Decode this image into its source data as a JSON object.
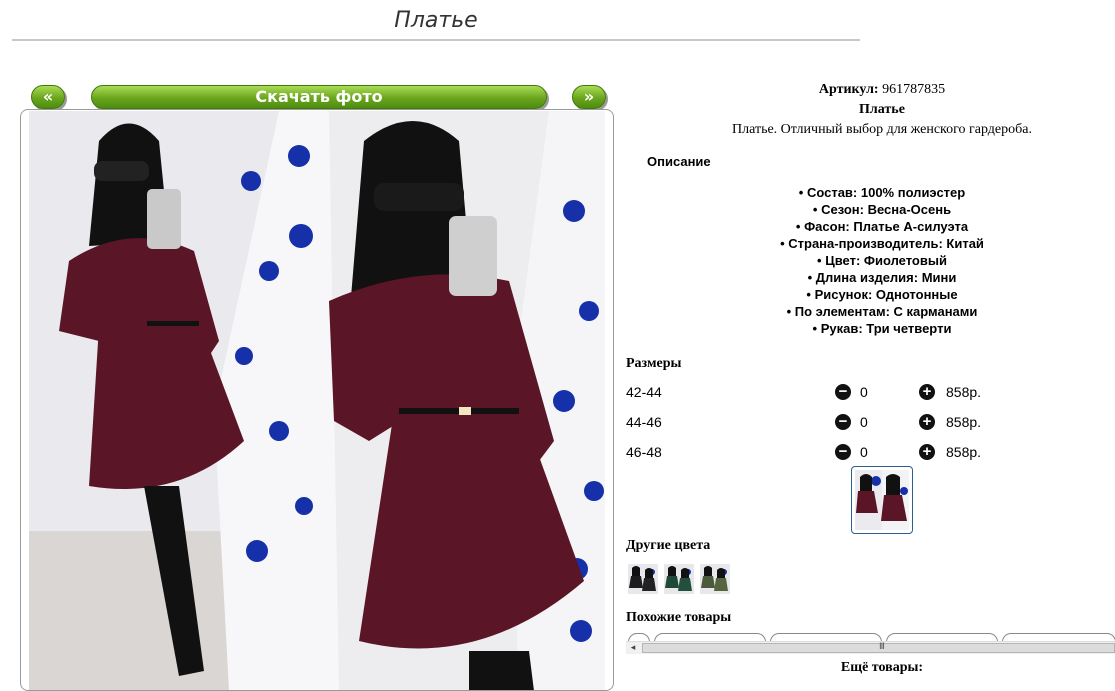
{
  "page": {
    "title": "Платье"
  },
  "nav": {
    "prev_label": "«",
    "download_label": "Скачать фото",
    "next_label": "»"
  },
  "product": {
    "article_label": "Артикул:",
    "article_value": "961787835",
    "name": "Платье",
    "short_description": "Платье. Отличный выбор для женского гардероба.",
    "description_heading": "Описание",
    "specs": [
      "Состав: 100% полиэстер",
      "Сезон: Весна-Осень",
      "Фасон: Платье А-силуэта",
      "Страна-производитель: Китай",
      "Цвет: Фиолетовый",
      "Длина изделия: Мини",
      "Рисунок: Однотонные",
      "По элементам: С карманами",
      "Рукав: Три четверти"
    ]
  },
  "sizes": {
    "heading": "Размеры",
    "rows": [
      {
        "label": "42-44",
        "qty": "0",
        "price": "858р."
      },
      {
        "label": "44-46",
        "qty": "0",
        "price": "858р."
      },
      {
        "label": "46-48",
        "qty": "0",
        "price": "858р."
      }
    ]
  },
  "other_colors": {
    "heading": "Другие цвета",
    "swatches": [
      "black",
      "green",
      "olive"
    ]
  },
  "similar": {
    "heading": "Похожие товары",
    "scroll_grip": "III"
  },
  "more": {
    "heading": "Ещё товары:"
  },
  "colors": {
    "accent_green": "#6aa61d",
    "dress": "#5a1626",
    "tree_ornament": "#1530a8"
  },
  "icons": {
    "minus": "minus-circle-icon",
    "plus": "plus-circle-icon"
  }
}
